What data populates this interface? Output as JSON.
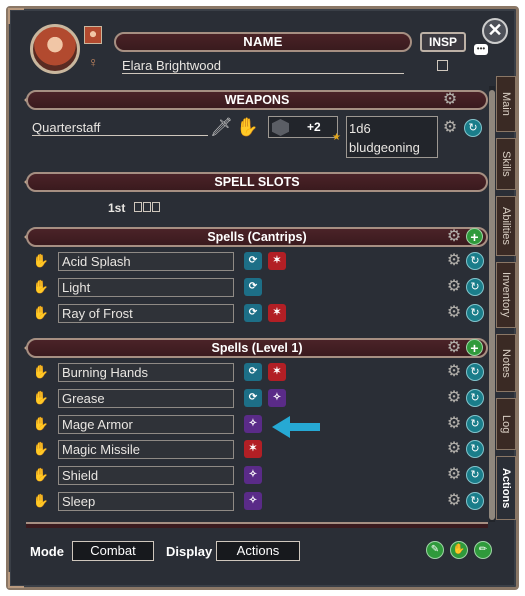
{
  "header": {
    "name_label": "NAME",
    "character_name": "Elara Brightwood",
    "insp_label": "INSP",
    "close_glyph": "✕"
  },
  "sections": {
    "weapons": "WEAPONS",
    "spell_slots": "SPELL SLOTS",
    "cantrips": "Spells (Cantrips)",
    "level1": "Spells (Level 1)"
  },
  "weapon": {
    "name": "Quarterstaff",
    "attack_bonus": "+2",
    "damage_line1": "1d6",
    "damage_line2": "bludgeoning"
  },
  "spell_slots": {
    "level_label": "1st",
    "slots": 3
  },
  "cantrips": [
    {
      "name": "Acid Splash",
      "tags": [
        "blue",
        "red"
      ]
    },
    {
      "name": "Light",
      "tags": [
        "blue"
      ]
    },
    {
      "name": "Ray of Frost",
      "tags": [
        "blue",
        "red"
      ]
    }
  ],
  "level1_spells": [
    {
      "name": "Burning Hands",
      "tags": [
        "blue",
        "red"
      ]
    },
    {
      "name": "Grease",
      "tags": [
        "blue",
        "purple"
      ]
    },
    {
      "name": "Mage Armor",
      "tags": [
        "purple"
      ]
    },
    {
      "name": "Magic Missile",
      "tags": [
        "red"
      ]
    },
    {
      "name": "Shield",
      "tags": [
        "purple"
      ]
    },
    {
      "name": "Sleep",
      "tags": [
        "purple"
      ]
    }
  ],
  "side_tabs": [
    "Main",
    "Skills",
    "Abilities",
    "Inventory",
    "Notes",
    "Log",
    "Actions"
  ],
  "active_tab": "Actions",
  "footer": {
    "mode_label": "Mode",
    "mode_value": "Combat",
    "display_label": "Display",
    "display_value": "Actions"
  },
  "colors": {
    "panel_bg": "#2a2e36",
    "banner_bg": "#4b2328",
    "accent_teal": "#1a7d8a",
    "accent_green": "#2f9a3b",
    "arrow": "#26a9d4"
  }
}
